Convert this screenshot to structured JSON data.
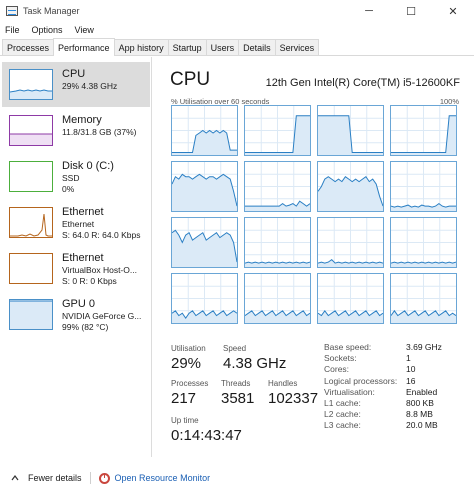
{
  "window": {
    "title": "Task Manager",
    "minimize_glyph": "─",
    "maximize_glyph": "☐",
    "close_glyph": "✕"
  },
  "menu": [
    "File",
    "Options",
    "View"
  ],
  "tabs": [
    "Processes",
    "Performance",
    "App history",
    "Startup",
    "Users",
    "Details",
    "Services"
  ],
  "active_tab": "Performance",
  "sidebar": {
    "items": [
      {
        "name": "CPU",
        "line1": "29%  4.38 GHz",
        "line2": "",
        "selected": true,
        "color": "#4a90c8"
      },
      {
        "name": "Memory",
        "line1": "11.8/31.8 GB (37%)",
        "line2": "",
        "selected": false,
        "color": "#8e3aa6"
      },
      {
        "name": "Disk 0 (C:)",
        "line1": "SSD",
        "line2": "0%",
        "selected": false,
        "color": "#4caf3c"
      },
      {
        "name": "Ethernet",
        "line1": "Ethernet",
        "line2": "S: 64.0  R: 64.0 Kbps",
        "selected": false,
        "color": "#b5651d"
      },
      {
        "name": "Ethernet",
        "line1": "VirtualBox Host-O...",
        "line2": "S: 0  R: 0 Kbps",
        "selected": false,
        "color": "#b5651d"
      },
      {
        "name": "GPU 0",
        "line1": "NVIDIA GeForce G...",
        "line2": "99% (82 °C)",
        "selected": false,
        "color": "#4a90c8"
      }
    ]
  },
  "main": {
    "title": "CPU",
    "model": "12th Gen Intel(R) Core(TM) i5-12600KF",
    "util_label": "% Utilisation over 60 seconds",
    "util_max": "100%",
    "stats": {
      "utilisation_label": "Utilisation",
      "utilisation_value": "29%",
      "speed_label": "Speed",
      "speed_value": "4.38 GHz",
      "processes_label": "Processes",
      "processes_value": "217",
      "threads_label": "Threads",
      "threads_value": "3581",
      "handles_label": "Handles",
      "handles_value": "102337",
      "uptime_label": "Up time",
      "uptime_value": "0:14:43:47"
    },
    "specs": [
      {
        "k": "Base speed:",
        "v": "3.69 GHz"
      },
      {
        "k": "Sockets:",
        "v": "1"
      },
      {
        "k": "Cores:",
        "v": "10"
      },
      {
        "k": "Logical processors:",
        "v": "16"
      },
      {
        "k": "Virtualisation:",
        "v": "Enabled"
      },
      {
        "k": "L1 cache:",
        "v": "800 KB"
      },
      {
        "k": "L2 cache:",
        "v": "8.8 MB"
      },
      {
        "k": "L3 cache:",
        "v": "20.0 MB"
      }
    ]
  },
  "footer": {
    "fewer_details": "Fewer details",
    "open_resource_monitor": "Open Resource Monitor"
  },
  "colors": {
    "cpu_line": "#2a7fc4",
    "cpu_fill": "#dbeaf7",
    "grid_line": "#dce9f5"
  }
}
